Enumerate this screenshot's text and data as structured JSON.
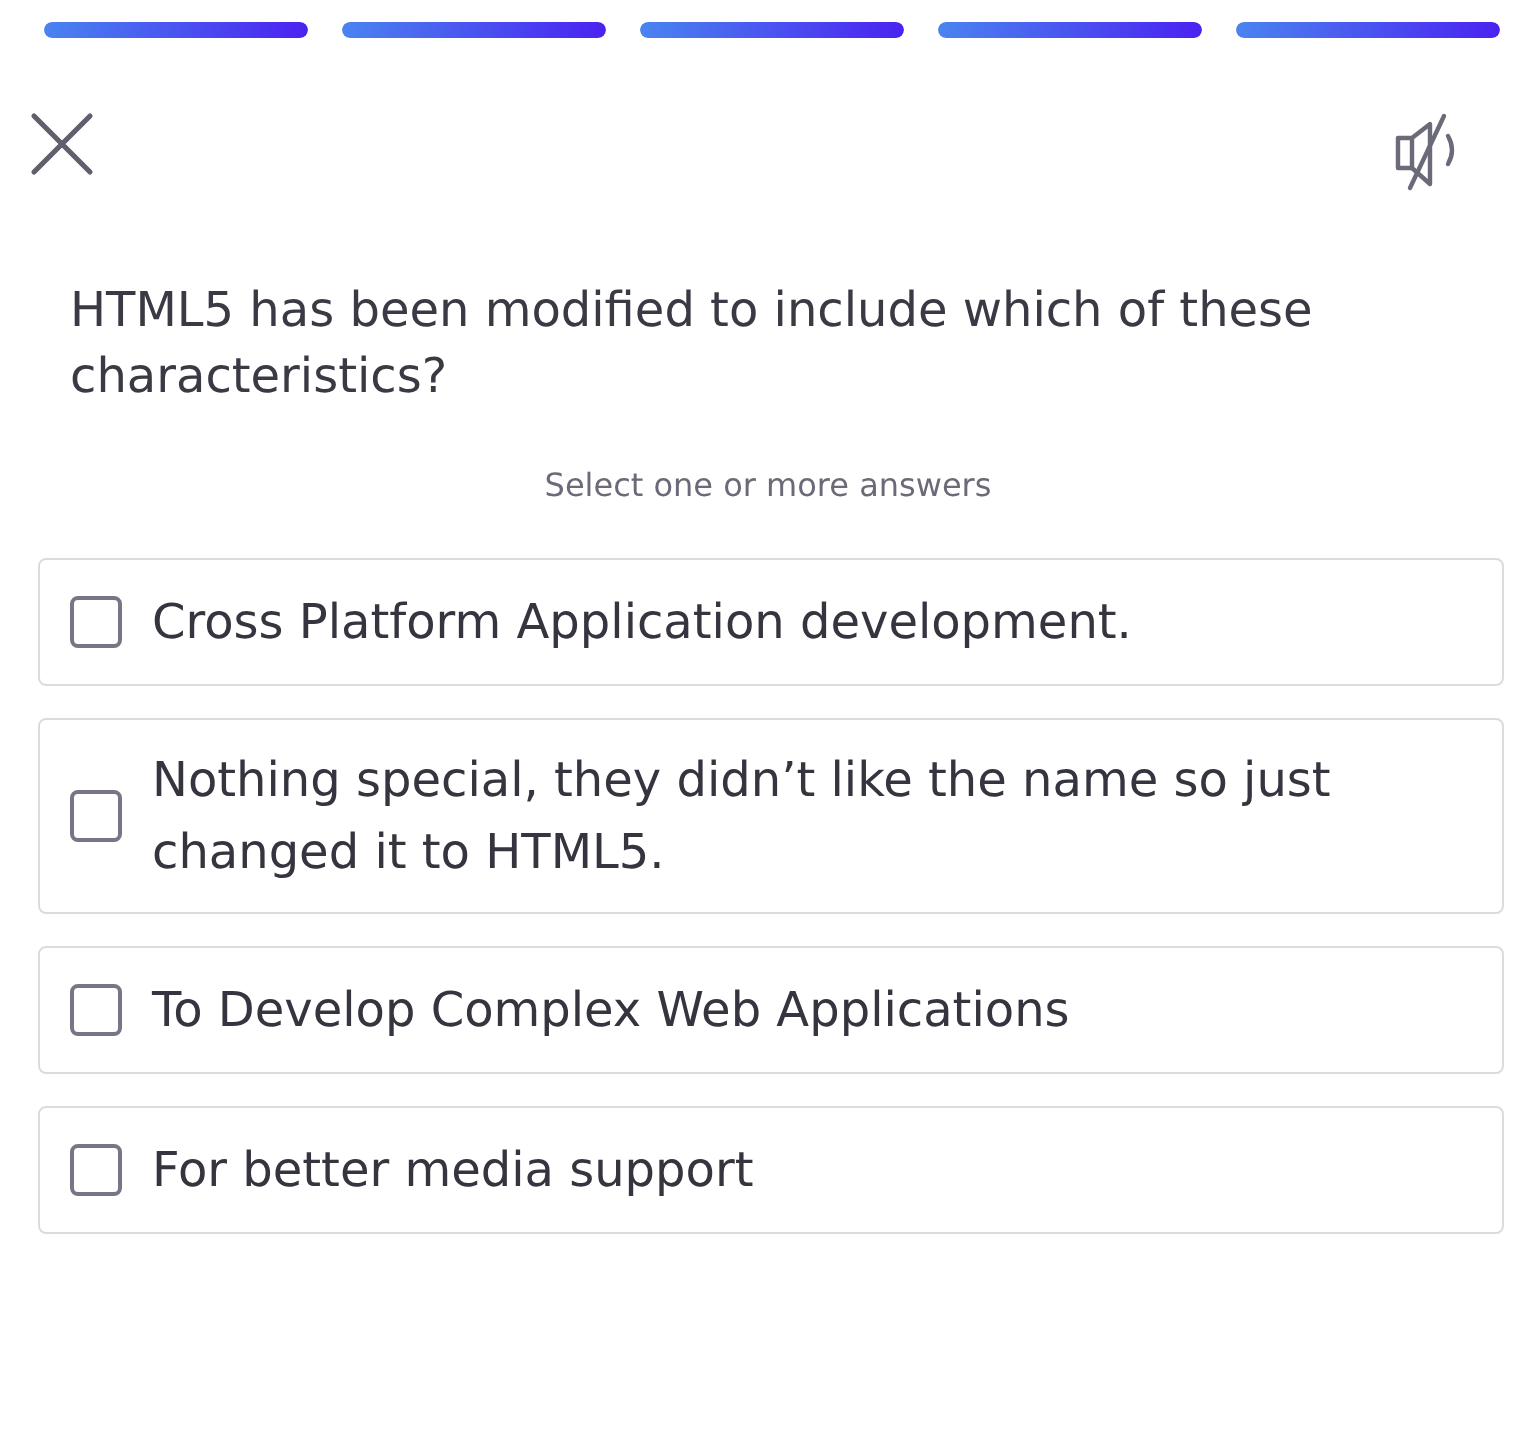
{
  "progress": [
    {
      "level": 1
    },
    {
      "level": 1
    },
    {
      "level": 1
    },
    {
      "level": 1
    },
    {
      "level": 1
    }
  ],
  "sound": {
    "muted": true
  },
  "question": "HTML5 has been modified to include which of these characteristics?",
  "hint": "Select one or more answers",
  "options": [
    {
      "text": "Cross Platform Application development.",
      "checked": false
    },
    {
      "text": "Nothing special, they didn’t like the name so just changed it to HTML5.",
      "checked": false
    },
    {
      "text": "To Develop Complex Web Applications",
      "checked": false
    },
    {
      "text": "For better media support",
      "checked": false
    }
  ]
}
